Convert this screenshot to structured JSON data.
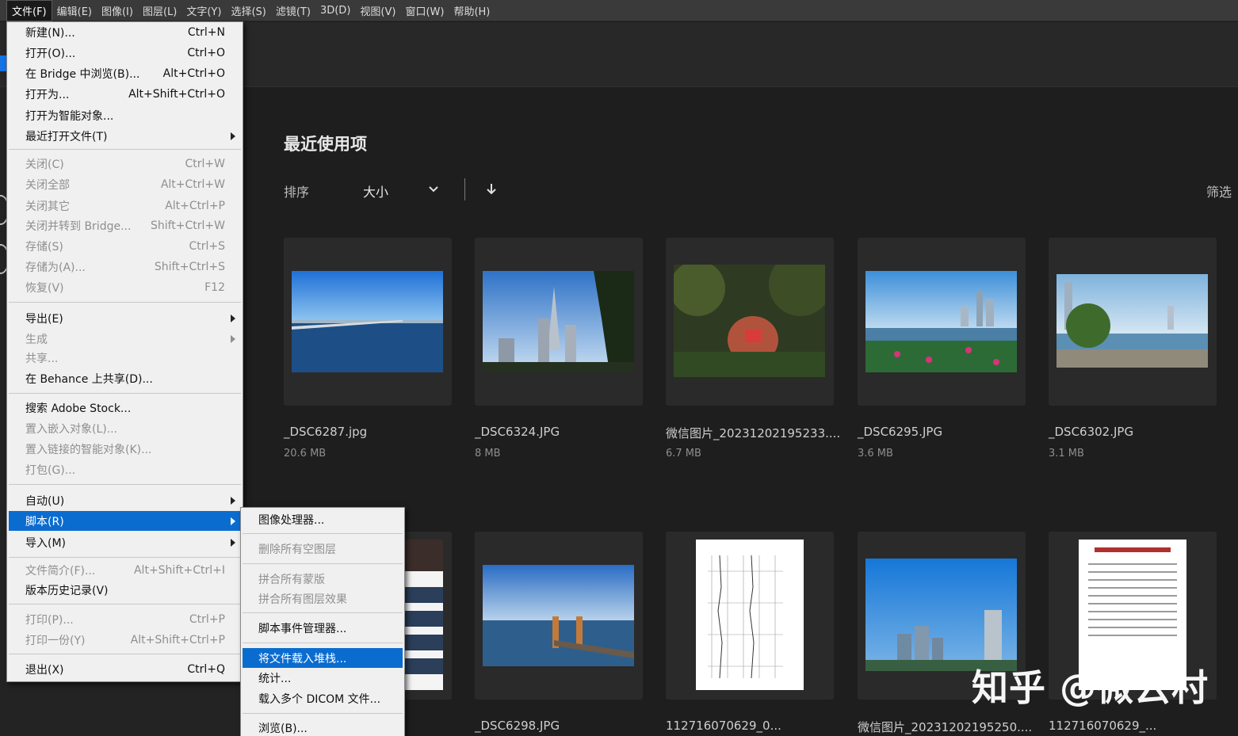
{
  "menubar": {
    "items": [
      "文件(F)",
      "编辑(E)",
      "图像(I)",
      "图层(L)",
      "文字(Y)",
      "选择(S)",
      "滤镜(T)",
      "3D(D)",
      "视图(V)",
      "窗口(W)",
      "帮助(H)"
    ]
  },
  "home": {
    "title": "最近使用项",
    "sort_label": "排序",
    "sort_value": "大小",
    "filter_label": "筛选"
  },
  "files": [
    {
      "name": "_DSC6287.jpg",
      "size": "20.6 MB"
    },
    {
      "name": "_DSC6324.JPG",
      "size": "8 MB"
    },
    {
      "name": "微信图片_20231202195233....",
      "size": "6.7 MB"
    },
    {
      "name": "_DSC6295.JPG",
      "size": "3.6 MB"
    },
    {
      "name": "_DSC6302.JPG",
      "size": "3.1 MB"
    },
    {
      "name": "_DSC6298.JPG",
      "size": ""
    },
    {
      "name": "112716070629_0...",
      "size": ""
    },
    {
      "name": "微信图片_20231202195250....",
      "size": ""
    },
    {
      "name": "112716070629_...",
      "size": ""
    }
  ],
  "file_menu": {
    "items": [
      {
        "label": "新建(N)...",
        "shortcut": "Ctrl+N"
      },
      {
        "label": "打开(O)...",
        "shortcut": "Ctrl+O"
      },
      {
        "label": "在 Bridge 中浏览(B)...",
        "shortcut": "Alt+Ctrl+O"
      },
      {
        "label": "打开为...",
        "shortcut": "Alt+Shift+Ctrl+O"
      },
      {
        "label": "打开为智能对象...",
        "shortcut": ""
      },
      {
        "label": "最近打开文件(T)",
        "shortcut": ""
      },
      {
        "label": "关闭(C)",
        "shortcut": "Ctrl+W"
      },
      {
        "label": "关闭全部",
        "shortcut": "Alt+Ctrl+W"
      },
      {
        "label": "关闭其它",
        "shortcut": "Alt+Ctrl+P"
      },
      {
        "label": "关闭并转到 Bridge...",
        "shortcut": "Shift+Ctrl+W"
      },
      {
        "label": "存储(S)",
        "shortcut": "Ctrl+S"
      },
      {
        "label": "存储为(A)...",
        "shortcut": "Shift+Ctrl+S"
      },
      {
        "label": "恢复(V)",
        "shortcut": "F12"
      },
      {
        "label": "导出(E)",
        "shortcut": ""
      },
      {
        "label": "生成",
        "shortcut": ""
      },
      {
        "label": "共享...",
        "shortcut": ""
      },
      {
        "label": "在 Behance 上共享(D)...",
        "shortcut": ""
      },
      {
        "label": "搜索 Adobe Stock...",
        "shortcut": ""
      },
      {
        "label": "置入嵌入对象(L)...",
        "shortcut": ""
      },
      {
        "label": "置入链接的智能对象(K)...",
        "shortcut": ""
      },
      {
        "label": "打包(G)...",
        "shortcut": ""
      },
      {
        "label": "自动(U)",
        "shortcut": ""
      },
      {
        "label": "脚本(R)",
        "shortcut": ""
      },
      {
        "label": "导入(M)",
        "shortcut": ""
      },
      {
        "label": "文件简介(F)...",
        "shortcut": "Alt+Shift+Ctrl+I"
      },
      {
        "label": "版本历史记录(V)",
        "shortcut": ""
      },
      {
        "label": "打印(P)...",
        "shortcut": "Ctrl+P"
      },
      {
        "label": "打印一份(Y)",
        "shortcut": "Alt+Shift+Ctrl+P"
      },
      {
        "label": "退出(X)",
        "shortcut": "Ctrl+Q"
      }
    ]
  },
  "scripts_menu": {
    "items": [
      {
        "label": "图像处理器..."
      },
      {
        "label": "删除所有空图层"
      },
      {
        "label": "拼合所有蒙版"
      },
      {
        "label": "拼合所有图层效果"
      },
      {
        "label": "脚本事件管理器..."
      },
      {
        "label": "将文件载入堆栈..."
      },
      {
        "label": "统计..."
      },
      {
        "label": "载入多个 DICOM 文件..."
      },
      {
        "label": "浏览(B)..."
      }
    ]
  },
  "watermark": "知乎 @微云村",
  "colors": {
    "highlight": "#0b6cd0",
    "background": "#1e1e1e"
  }
}
